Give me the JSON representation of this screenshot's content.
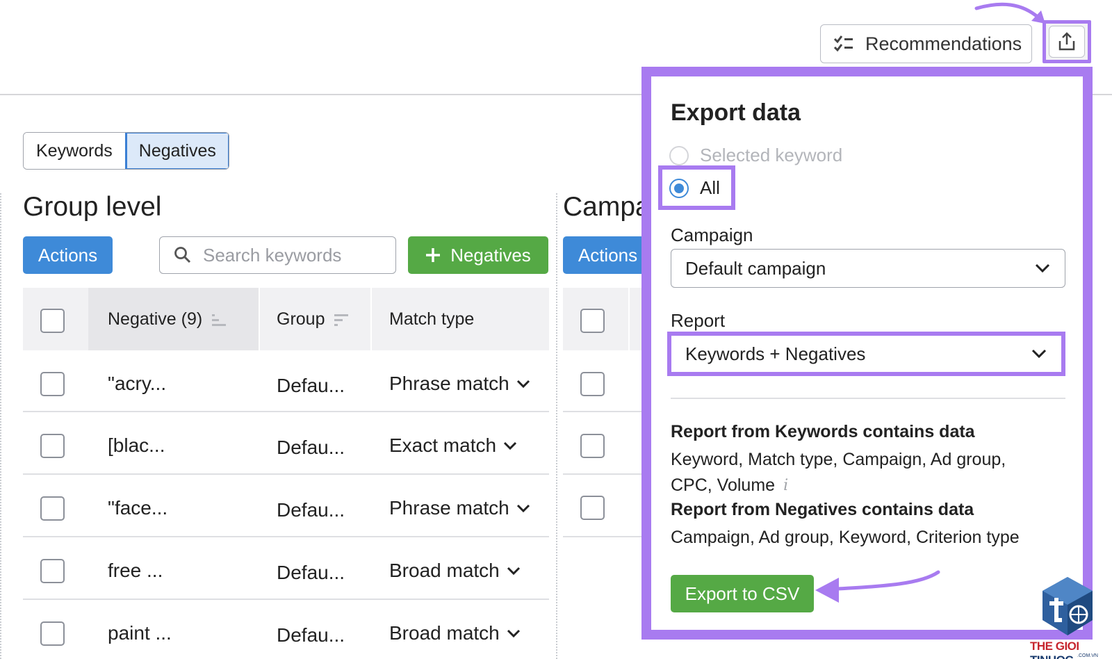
{
  "toolbar": {
    "recommendations_label": "Recommendations"
  },
  "tabs": [
    {
      "label": "Keywords",
      "active": false
    },
    {
      "label": "Negatives",
      "active": true
    }
  ],
  "group_level": {
    "title": "Group level",
    "actions_label": "Actions",
    "search_placeholder": "Search keywords",
    "add_negatives_label": "Negatives",
    "columns": {
      "negative": "Negative (9)",
      "group": "Group",
      "match_type": "Match type"
    },
    "rows": [
      {
        "negative": "\"acry...",
        "group": "Defau...",
        "match_type": "Phrase match"
      },
      {
        "negative": "[blac...",
        "group": "Defau...",
        "match_type": "Exact match"
      },
      {
        "negative": "\"face...",
        "group": "Defau...",
        "match_type": "Phrase match"
      },
      {
        "negative": "free ...",
        "group": "Defau...",
        "match_type": "Broad match"
      },
      {
        "negative": "paint ...",
        "group": "Defau...",
        "match_type": "Broad match"
      }
    ]
  },
  "campaign_level": {
    "title": "Campa",
    "actions_label": "Actions"
  },
  "export_panel": {
    "title": "Export data",
    "options": [
      {
        "label": "Selected keyword",
        "selected": false,
        "disabled": true
      },
      {
        "label": "All",
        "selected": true,
        "disabled": false
      }
    ],
    "campaign_label": "Campaign",
    "campaign_value": "Default campaign",
    "report_label": "Report",
    "report_value": "Keywords + Negatives",
    "keywords_heading": "Report from Keywords contains data",
    "keywords_fields_line1": "Keyword, Match type, Campaign, Ad group,",
    "keywords_fields_line2": "CPC, Volume",
    "info_mark": "i",
    "negatives_heading": "Report from Negatives contains data",
    "negatives_fields": "Campaign, Ad group, Keyword, Criterion type",
    "export_button_label": "Export to CSV"
  },
  "watermark": {
    "brand_red": "THE GIOI",
    "brand_blue": "TINHOC",
    "domain": ".COM.VN"
  },
  "colors": {
    "accent_purple": "#a87bf0",
    "primary_blue": "#3e8ad8",
    "success_green": "#55a945"
  }
}
